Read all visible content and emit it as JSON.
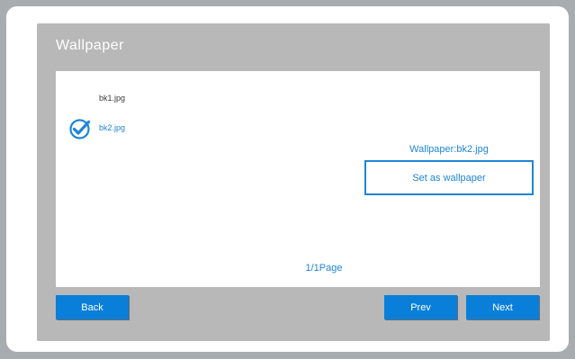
{
  "window": {
    "title": "Wallpaper"
  },
  "file_list": {
    "items": [
      {
        "name": "bk1.jpg",
        "selected": false
      },
      {
        "name": "bk2.jpg",
        "selected": true
      }
    ]
  },
  "status": {
    "current_wallpaper": "Wallpaper:bk2.jpg"
  },
  "actions": {
    "set_wallpaper_label": "Set as wallpaper"
  },
  "pagination": {
    "indicator": "1/1Page"
  },
  "buttons": {
    "back": "Back",
    "prev": "Prev",
    "next": "Next"
  },
  "icons": {
    "selected_marker": "check-circle-icon"
  },
  "colors": {
    "accent": "#1f85d6",
    "button_fill": "#0a7fd9",
    "panel": "#b7b8b7",
    "background": "#a7acb1"
  }
}
